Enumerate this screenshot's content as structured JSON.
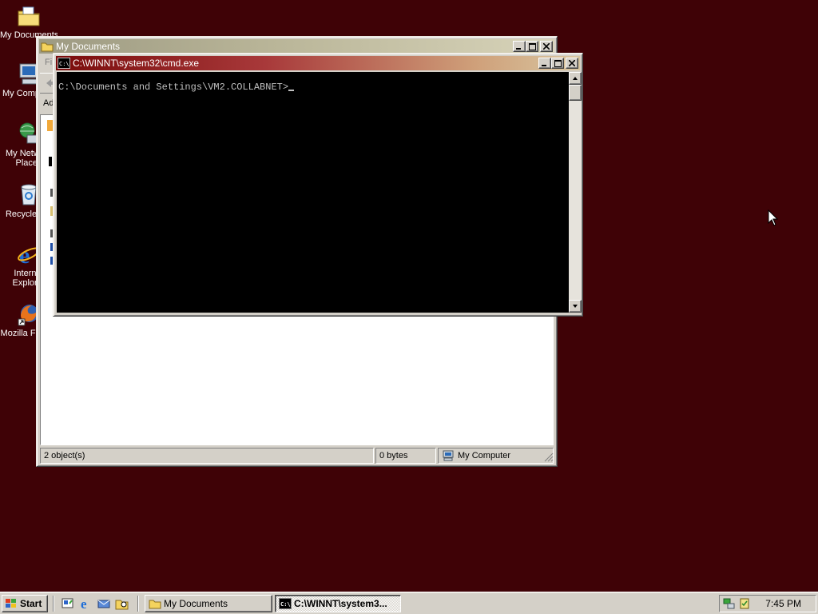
{
  "desktop": {
    "background_color": "#3f0206",
    "icons": [
      {
        "label": "My Documents",
        "icon": "folder-documents-icon"
      },
      {
        "label": "My Computer",
        "icon": "computer-icon"
      },
      {
        "label": "My Network Places",
        "icon": "network-places-icon"
      },
      {
        "label": "Recycle Bin",
        "icon": "recycle-bin-icon"
      },
      {
        "label": "Internet Explorer",
        "icon": "internet-explorer-icon"
      },
      {
        "label": "Mozilla Firefox",
        "icon": "firefox-icon"
      }
    ]
  },
  "mydocs_window": {
    "title": "My Documents",
    "menu_partial": "Fi",
    "addr_partial": "Ad",
    "status": {
      "objects": "2 object(s)",
      "size": "0 bytes",
      "zone": "My Computer"
    }
  },
  "cmd_window": {
    "title": "C:\\WINNT\\system32\\cmd.exe",
    "prompt": "C:\\Documents and Settings\\VM2.COLLABNET>"
  },
  "taskbar": {
    "start_label": "Start",
    "tasks": [
      {
        "label": "My Documents",
        "active": false
      },
      {
        "label": "C:\\WINNT\\system3...",
        "active": true
      }
    ],
    "clock": "7:45 PM"
  },
  "colors": {
    "active_title": "#7a0b0b",
    "inactive_title": "#9d9a82",
    "chrome": "#d4d0c8"
  }
}
